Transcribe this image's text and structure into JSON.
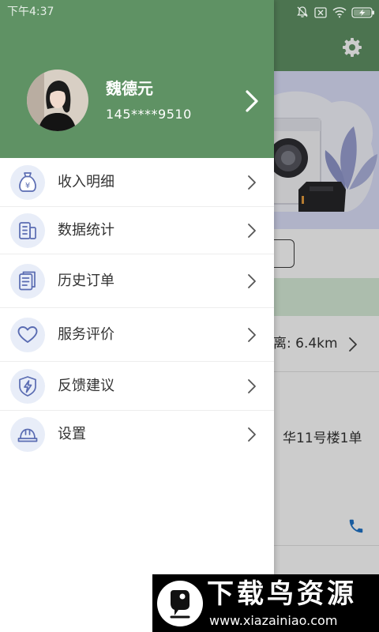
{
  "status_bar": {
    "time": "下午4:37",
    "icons": [
      "bell-off-icon",
      "sim-off-icon",
      "wifi-icon",
      "battery-charging-icon"
    ]
  },
  "drawer": {
    "user": {
      "name": "魏德元",
      "phone": "145****9510"
    },
    "menu": [
      {
        "label": "收入明细",
        "icon": "money-bag-icon",
        "icon_text": "¥"
      },
      {
        "label": "数据统计",
        "icon": "statistics-icon"
      },
      {
        "label": "历史订单",
        "icon": "order-history-icon"
      },
      {
        "label": "服务评价",
        "icon": "heart-icon"
      },
      {
        "label": "反馈建议",
        "icon": "shield-bolt-icon"
      },
      {
        "label": "设置",
        "icon": "helmet-icon"
      }
    ]
  },
  "main_page": {
    "header_icon": "gear-icon",
    "distance_text": "离: 6.4km",
    "address_text": "华11号楼1单",
    "contact_icon": "phone-icon"
  },
  "watermark": {
    "title": "下载鸟资源",
    "url": "www.xiazainiao.com"
  },
  "colors": {
    "primary_green": "#5f9264",
    "icon_circle": "#e8edf8",
    "icon_stroke": "#5a6cb2",
    "menu_text": "#333333",
    "accent_blue": "#1e73c8",
    "scrim": "rgba(0,0,0,0.2)"
  }
}
